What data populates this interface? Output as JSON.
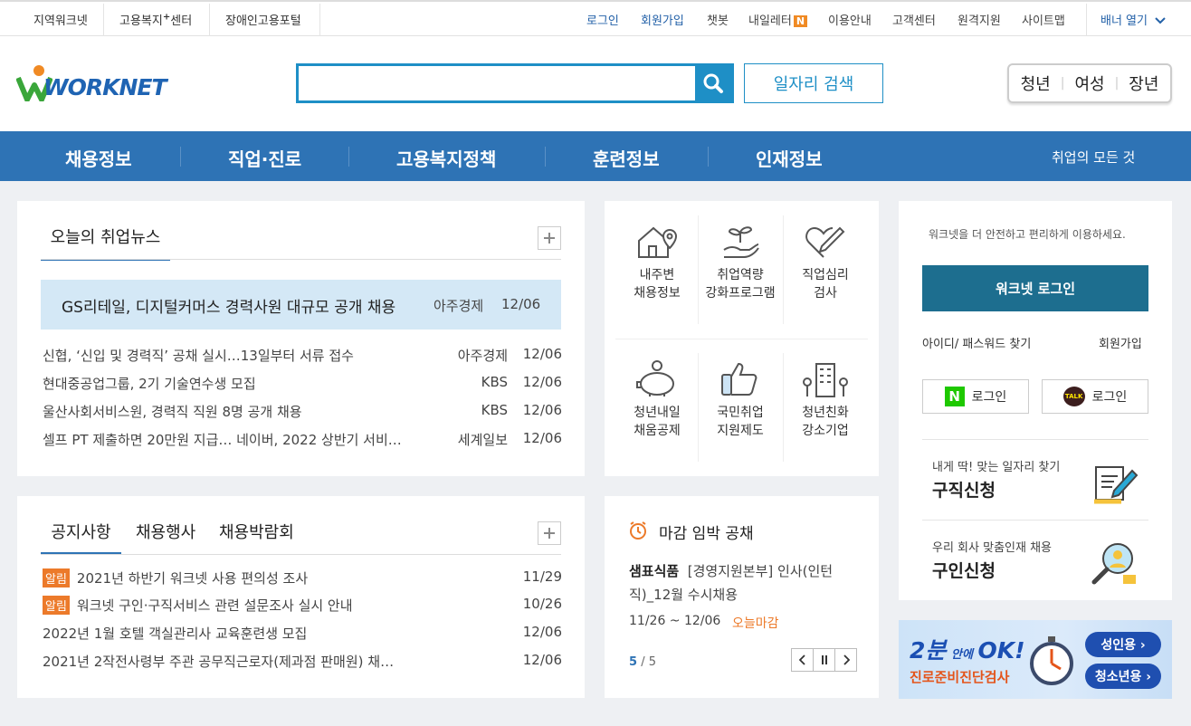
{
  "topbar": {
    "left": [
      "지역워크넷",
      "고용복지",
      "센터",
      "장애인고용포털"
    ],
    "right": [
      "로그인",
      "회원가입",
      "챗봇",
      "내일레터",
      "N",
      "이용안내",
      "고객센터",
      "원격지원",
      "사이트맵"
    ],
    "banner": "배너 열기"
  },
  "header": {
    "logo": "WORKNET",
    "search_placeholder": "",
    "search_button": "일자리 검색",
    "tabs": [
      "청년",
      "여성",
      "장년"
    ]
  },
  "nav": {
    "items": [
      "채용정보",
      "직업·진로",
      "고용복지정책",
      "훈련정보",
      "인재정보"
    ],
    "right": "취업의 모든 것"
  },
  "news": {
    "title": "오늘의 취업뉴스",
    "featured": {
      "title": "GS리테일, 디지털커머스 경력사원 대규모 공개 채용",
      "source": "아주경제",
      "date": "12/06"
    },
    "items": [
      {
        "title": "신협, ‘신입 및 경력직’ 공채 실시…13일부터 서류 접수",
        "source": "아주경제",
        "date": "12/06"
      },
      {
        "title": "현대중공업그룹, 2기 기술연수생 모집",
        "source": "KBS",
        "date": "12/06"
      },
      {
        "title": "울산사회서비스원, 경력직 직원 8명 공개 채용",
        "source": "KBS",
        "date": "12/06"
      },
      {
        "title": "셀프 PT 제출하면 20만원 지급… 네이버, 2022 상반기 서비…",
        "source": "세계일보",
        "date": "12/06"
      }
    ]
  },
  "notice": {
    "tabs": [
      "공지사항",
      "채용행사",
      "채용박람회"
    ],
    "items": [
      {
        "tag": "알림",
        "title": "2021년 하반기 워크넷 사용 편의성 조사",
        "date": "11/29"
      },
      {
        "tag": "알림",
        "title": "워크넷 구인·구직서비스 관련 설문조사 실시 안내",
        "date": "10/26"
      },
      {
        "tag": "",
        "title": "2022년 1월 호텔 객실관리사 교육훈련생 모집",
        "date": "12/06"
      },
      {
        "tag": "",
        "title": "2021년 2작전사령부 주관 공무직근로자(제과점 판매원) 채…",
        "date": "12/06"
      }
    ]
  },
  "services": [
    {
      "l1": "내주변",
      "l2": "채용정보",
      "icon": "house-pin-icon"
    },
    {
      "l1": "취업역량",
      "l2": "강화프로그램",
      "icon": "sprout-hand-icon"
    },
    {
      "l1": "직업심리",
      "l2": "검사",
      "icon": "heart-pen-icon"
    },
    {
      "l1": "청년내일",
      "l2": "채움공제",
      "icon": "piggy-bank-icon"
    },
    {
      "l1": "국민취업",
      "l2": "지원제도",
      "icon": "thumbs-up-icon"
    },
    {
      "l1": "청년친화",
      "l2": "강소기업",
      "icon": "building-icon"
    }
  ],
  "deadline": {
    "title": "마감 임박 공채",
    "company": "샘표식품",
    "desc1": "[경영지원본부] 인사(인턴",
    "desc2": "직)_12월 수시채용",
    "period": "11/26 ~ 12/06",
    "status": "오늘마감",
    "page_cur": "5",
    "page_total": "/ 5"
  },
  "login": {
    "intro": "워크넷을 더 안전하고 편리하게 이용하세요.",
    "button": "워크넷 로그인",
    "find": "아이디/ 패스워드 찾기",
    "join": "회원가입",
    "naver": "로그인",
    "kakao": "로그인",
    "naver_badge": "N",
    "kakao_badge": "TALK",
    "seek_sub": "내게 딱! 맞는 일자리 찾기",
    "seek_title": "구직신청",
    "hire_sub": "우리 회사 맞춤인재 채용",
    "hire_title": "구인신청"
  },
  "banner": {
    "big": "2분",
    "small": "안에",
    "ok": "OK!",
    "sub": "진로준비진단검사",
    "b1": "성인용 ›",
    "b2": "청소년용 ›"
  },
  "colors": {
    "nav": "#2e73b5",
    "accent": "#1e8fc6",
    "login_btn": "#1d6e8f",
    "tag": "#ec7a2a"
  }
}
